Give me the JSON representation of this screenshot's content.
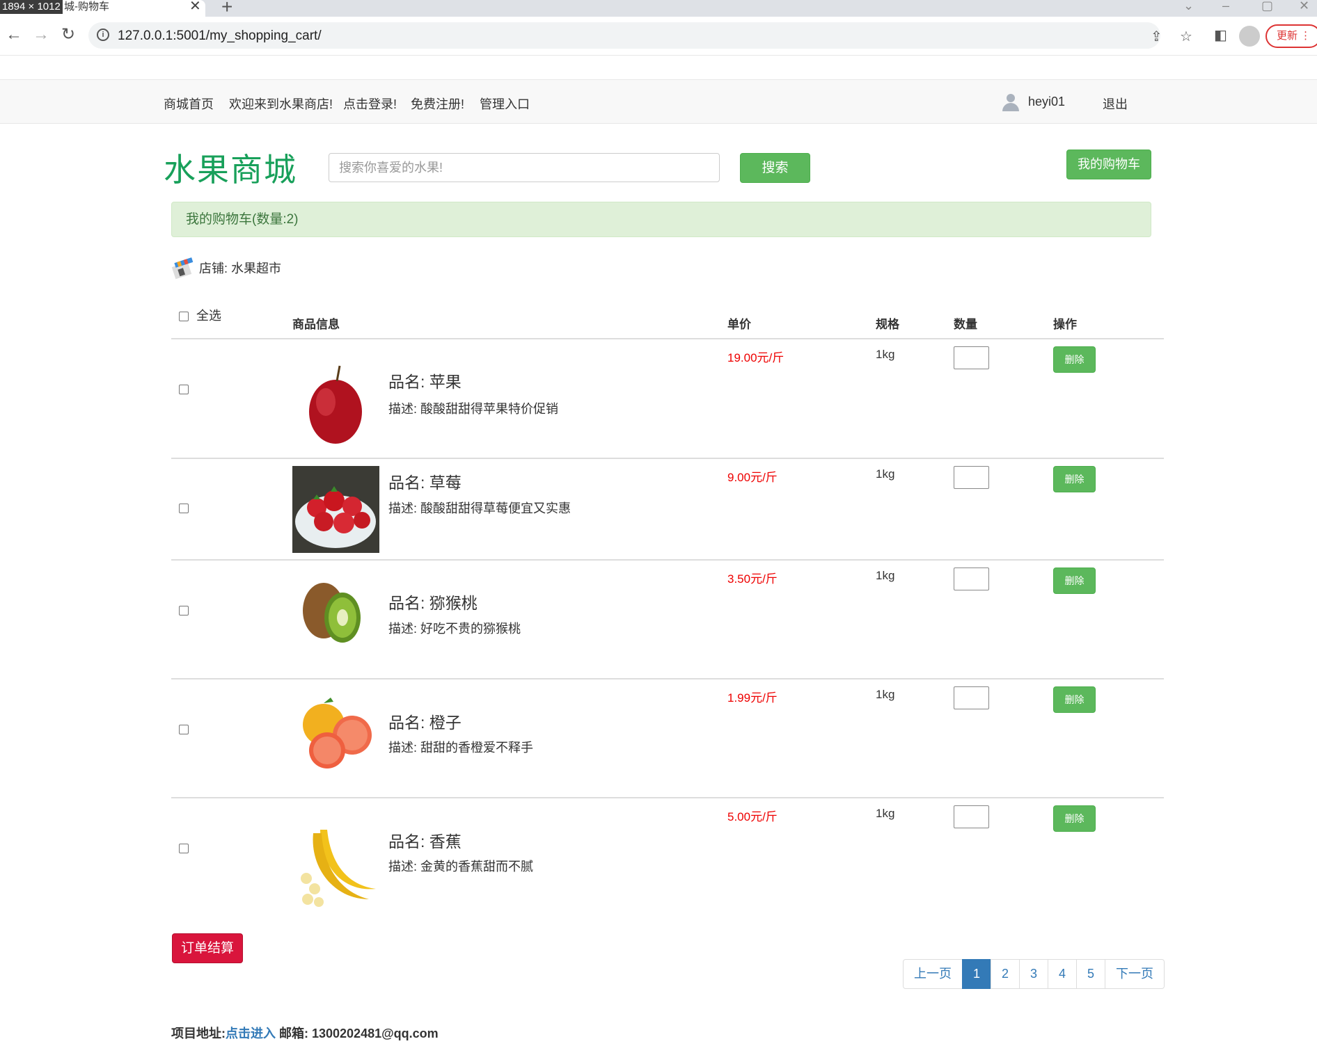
{
  "browser": {
    "dimensions_badge": "1894 × 1012",
    "tab_title": "城-购物车",
    "url": "127.0.0.1:5001/my_shopping_cart/",
    "update_label": "更新"
  },
  "topnav": {
    "items": [
      "商城首页",
      "欢迎来到水果商店!",
      "点击登录!",
      "免费注册!",
      "管理入口"
    ],
    "username": "heyi01",
    "logout": "退出"
  },
  "header": {
    "logo": "水果商城",
    "search_placeholder": "搜索你喜爱的水果!",
    "search_button": "搜索",
    "cart_button": "我的购物车"
  },
  "cart": {
    "title": "我的购物车(数量:2)",
    "shop_label": "店铺: 水果超市",
    "select_all": "全选",
    "columns": {
      "info": "商品信息",
      "price": "单价",
      "spec": "规格",
      "qty": "数量",
      "op": "操作"
    },
    "items": [
      {
        "name": "品名:  苹果",
        "desc": "描述:  酸酸甜甜得苹果特价促销",
        "price": "19.00元/斤",
        "spec": "1kg",
        "delete": "删除"
      },
      {
        "name": "品名:  草莓",
        "desc": "描述:  酸酸甜甜得草莓便宜又实惠",
        "price": "9.00元/斤",
        "spec": "1kg",
        "delete": "删除"
      },
      {
        "name": "品名:  猕猴桃",
        "desc": "描述:  好吃不贵的猕猴桃",
        "price": "3.50元/斤",
        "spec": "1kg",
        "delete": "删除"
      },
      {
        "name": "品名:  橙子",
        "desc": "描述:  甜甜的香橙爱不释手",
        "price": "1.99元/斤",
        "spec": "1kg",
        "delete": "删除"
      },
      {
        "name": "品名:  香蕉",
        "desc": "描述:  金黄的香蕉甜而不腻",
        "price": "5.00元/斤",
        "spec": "1kg",
        "delete": "删除"
      }
    ],
    "checkout": "订单结算"
  },
  "pagination": {
    "prev": "上一页",
    "pages": [
      "1",
      "2",
      "3",
      "4",
      "5"
    ],
    "next": "下一页"
  },
  "footer": {
    "project_label": "项目地址:",
    "project_link": "点击进入",
    "email_label": " 邮箱: 1300202481@qq.com"
  }
}
